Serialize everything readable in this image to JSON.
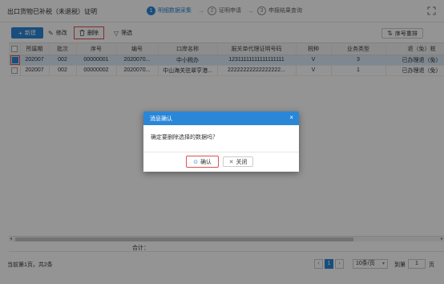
{
  "window": {
    "title": "出口货物已补税（未退税）证明"
  },
  "steps": [
    {
      "num": "1",
      "label": "明细数据采集",
      "active": true
    },
    {
      "num": "2",
      "label": "证明申请",
      "active": false
    },
    {
      "num": "3",
      "label": "申报结果查询",
      "active": false
    }
  ],
  "toolbar": {
    "new_label": "新建",
    "edit_label": "修改",
    "delete_label": "删除",
    "filter_label": "筛选",
    "reorder_label": "序号重排"
  },
  "table": {
    "columns": [
      "所属期",
      "批次",
      "序号",
      "编号",
      "口岸名称",
      "报关单代理证明号码",
      "税种",
      "业务类型",
      "退（免）税"
    ],
    "rows": [
      {
        "checked": true,
        "cells": [
          "202007",
          "002",
          "00000001",
          "2020070...",
          "中小税办",
          "12311111111111111111",
          "V",
          "3",
          "已办理退（免）"
        ]
      },
      {
        "checked": false,
        "cells": [
          "202007",
          "002",
          "00000002",
          "2020070...",
          "中山海关驻翠亨港...",
          "22222222222222222...",
          "V",
          "1",
          "已办理退（免）"
        ]
      }
    ]
  },
  "footer": {
    "total_label": "合计："
  },
  "pager": {
    "info": "当前第1页，共2条",
    "prev": "‹",
    "current": "1",
    "next": "›",
    "page_size": "10条/页",
    "goto_label": "到第",
    "goto_value": "1",
    "page_suffix": "页"
  },
  "dialog": {
    "title": "消息确认",
    "message": "确定要删除选择的数据吗？",
    "ok_label": "确认",
    "cancel_label": "关闭",
    "close_glyph": "×"
  },
  "colors": {
    "accent": "#2a87d8",
    "highlight": "#e05050"
  }
}
